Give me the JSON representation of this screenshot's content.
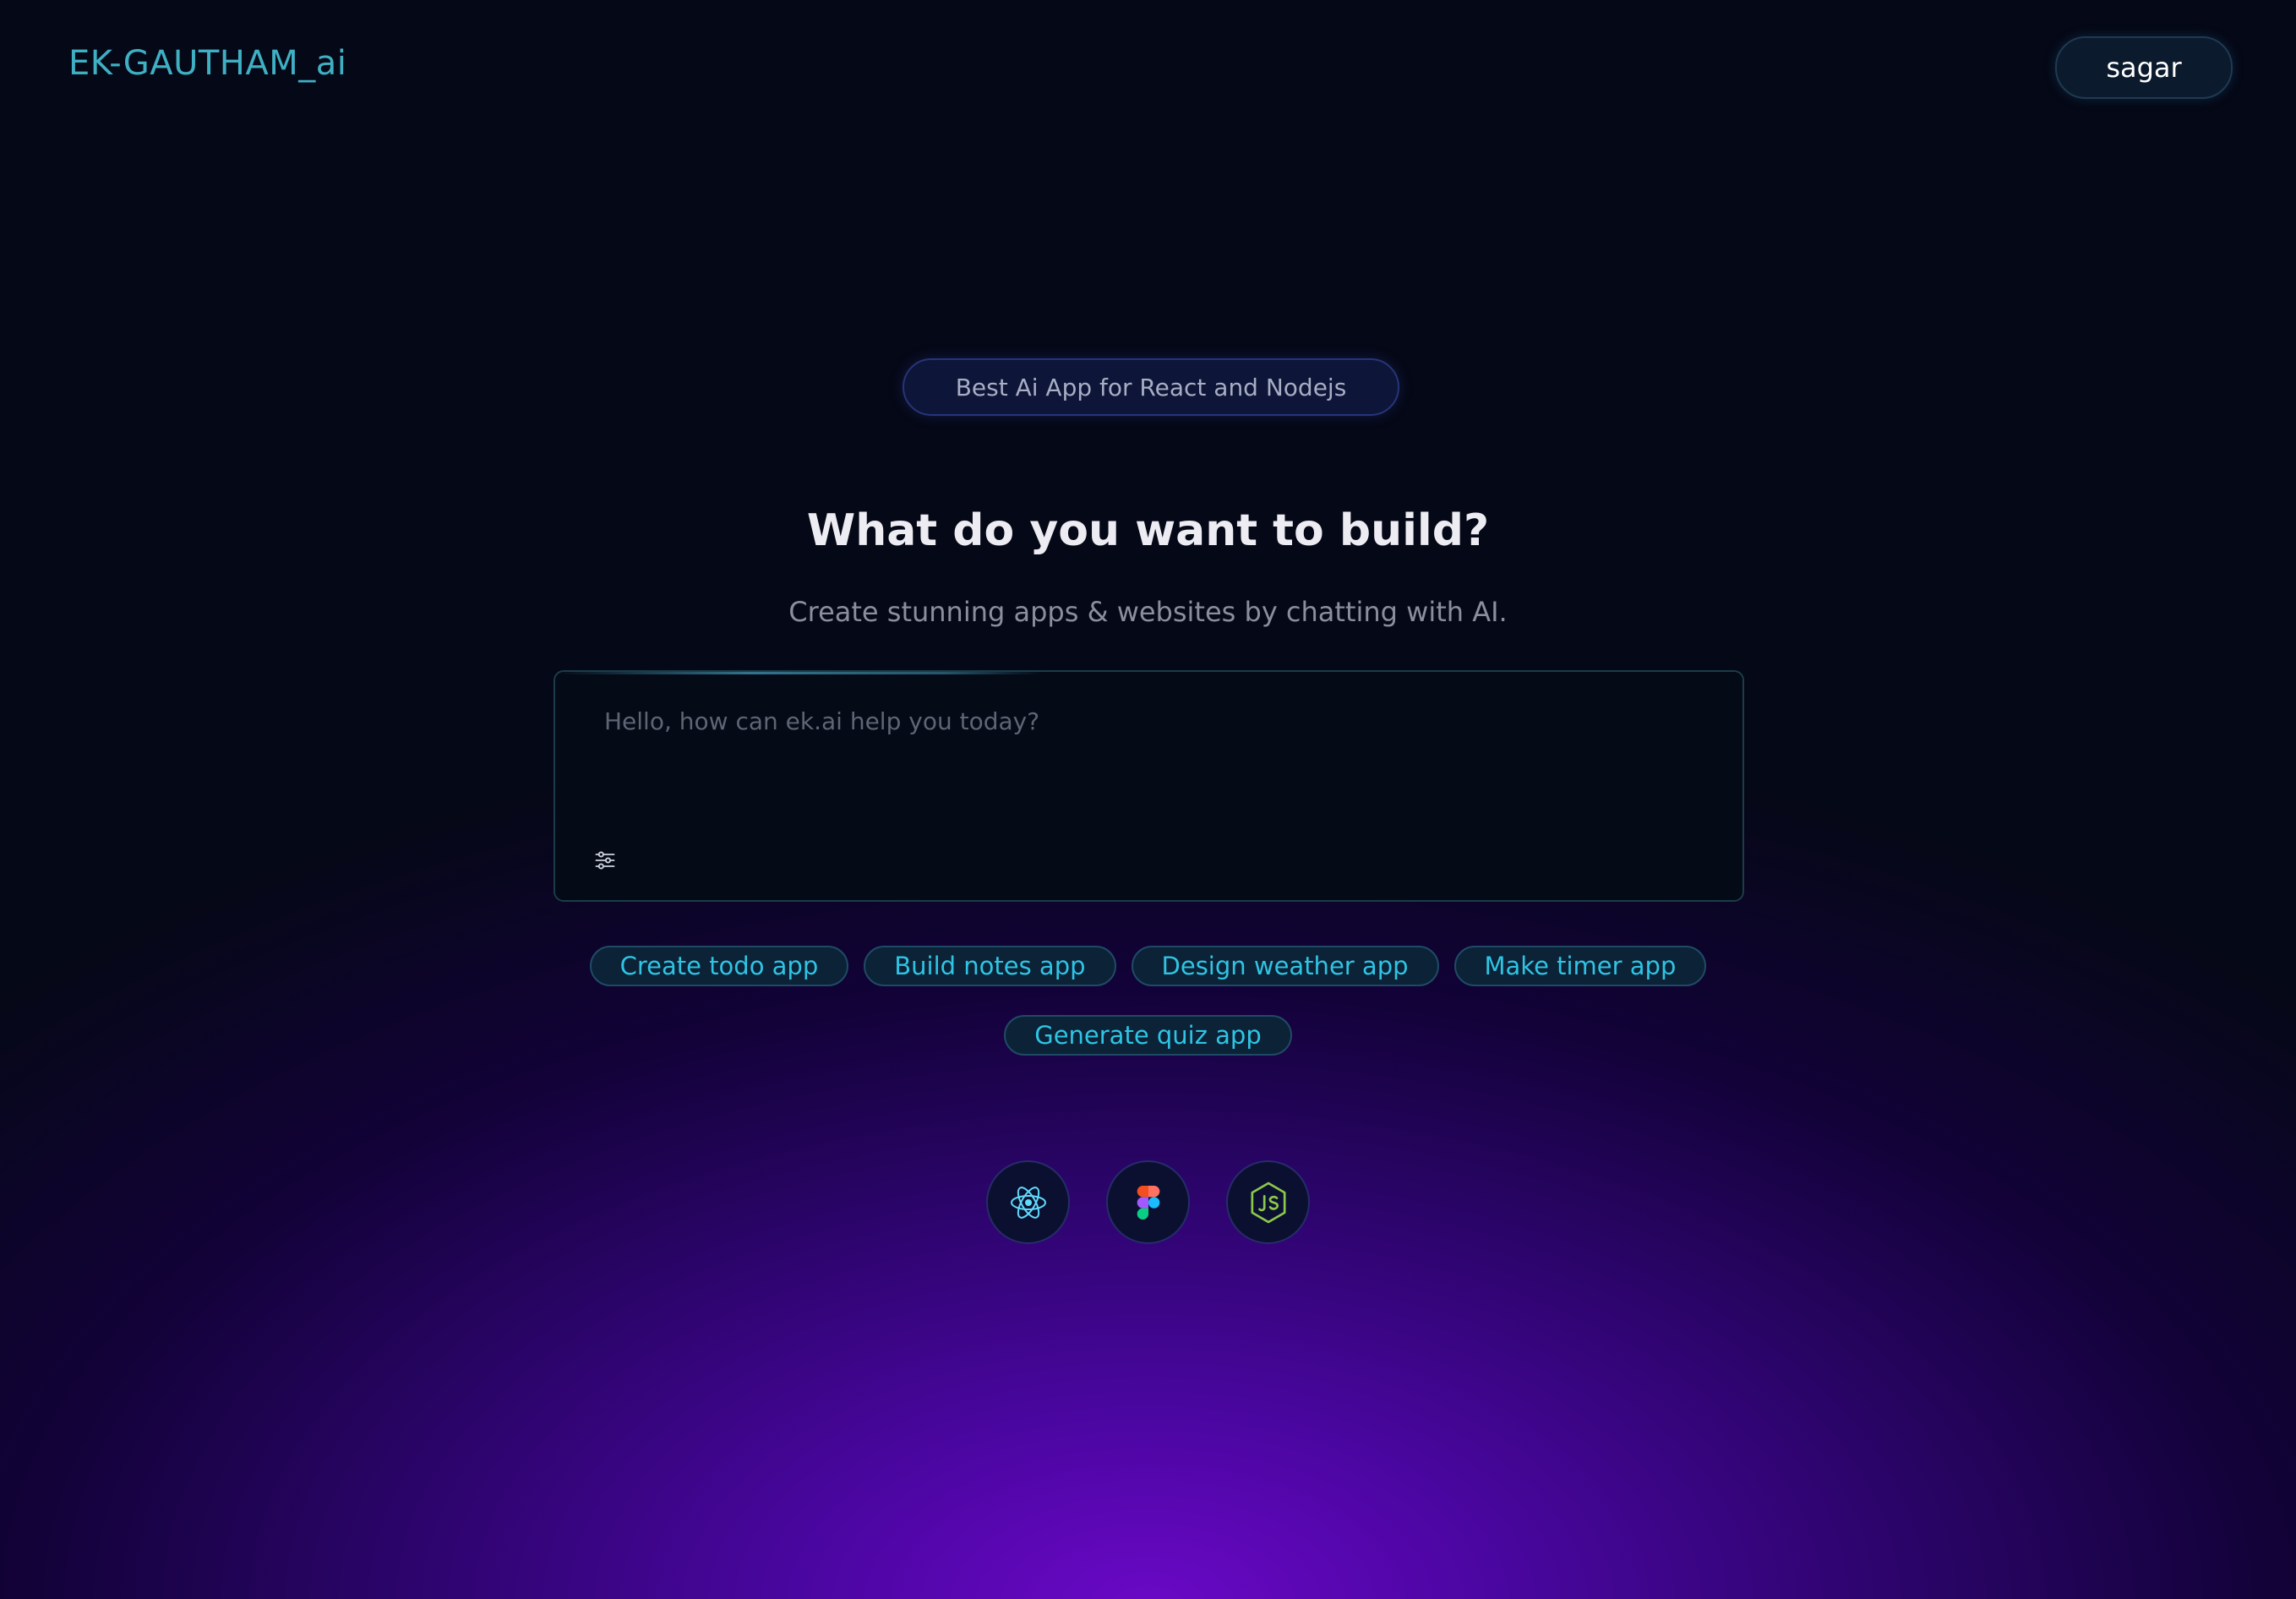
{
  "header": {
    "logo_text": "EK-GAUTHAM_ai",
    "user_label": "sagar"
  },
  "hero": {
    "tagline": "Best Ai App for React and Nodejs",
    "title": "What do you want to build?",
    "subtitle": "Create stunning apps & websites by chatting with AI."
  },
  "prompt": {
    "placeholder": "Hello, how can ek.ai help you today?",
    "value": "",
    "settings_icon": "sliders-icon"
  },
  "suggestions": [
    {
      "label": "Create todo app"
    },
    {
      "label": "Build notes app"
    },
    {
      "label": "Design weather app"
    },
    {
      "label": "Make timer app"
    },
    {
      "label": "Generate quiz app"
    }
  ],
  "tech_icons": [
    {
      "icon": "react-icon",
      "color": "#61dafb"
    },
    {
      "icon": "figma-icon",
      "color": "#f24e1e"
    },
    {
      "icon": "nodejs-icon",
      "color": "#8cc84b"
    }
  ],
  "colors": {
    "background": "#050816",
    "glow": "#6a08c6",
    "accent": "#2fc4e4",
    "logo": "#3fb0c4"
  }
}
